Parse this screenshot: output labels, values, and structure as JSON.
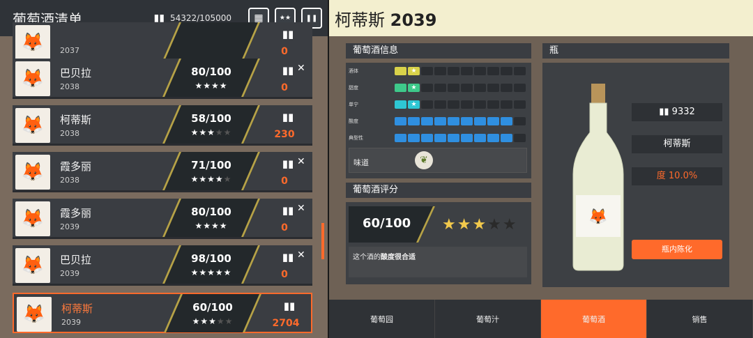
{
  "left": {
    "title": "葡萄酒清单",
    "count_icon": "wine-bottles-icon",
    "count": "54322/105000",
    "buttons": [
      {
        "name": "calendar-icon",
        "glyph": "▦"
      },
      {
        "name": "stars-icon",
        "glyph": "★★"
      },
      {
        "name": "wine-bottles-icon",
        "glyph": "❚❚"
      }
    ]
  },
  "wines": [
    {
      "name": "",
      "year": "2037",
      "score": "",
      "stars": "",
      "qty": "0",
      "close": false,
      "selected": false
    },
    {
      "name": "巴贝拉",
      "year": "2038",
      "score": "80/100",
      "stars_on": "★★★★",
      "stars_off": "",
      "qty": "0",
      "close": true,
      "selected": false
    },
    {
      "name": "柯蒂斯",
      "year": "2038",
      "score": "58/100",
      "stars_on": "★★★",
      "stars_off": "★★",
      "qty": "230",
      "close": false,
      "selected": false
    },
    {
      "name": "霞多丽",
      "year": "2038",
      "score": "71/100",
      "stars_on": "★★★★",
      "stars_off": "★",
      "qty": "0",
      "close": true,
      "selected": false
    },
    {
      "name": "霞多丽",
      "year": "2039",
      "score": "80/100",
      "stars_on": "★★★★",
      "stars_off": "",
      "qty": "0",
      "close": true,
      "selected": false
    },
    {
      "name": "巴贝拉",
      "year": "2039",
      "score": "98/100",
      "stars_on": "★★★★★",
      "stars_off": "",
      "qty": "0",
      "close": true,
      "selected": false
    },
    {
      "name": "柯蒂斯",
      "year": "2039",
      "score": "60/100",
      "stars_on": "★★★",
      "stars_off": "★★",
      "qty": "2704",
      "close": false,
      "selected": true
    }
  ],
  "close_glyph": "✕",
  "fox_glyph": "🦊",
  "bottles_glyph": "▮▮",
  "right": {
    "title_name": "柯蒂斯",
    "title_year": "2039",
    "info_header": "葡萄酒信息",
    "traits": [
      {
        "label": "酒体",
        "level": 2,
        "color": "#d9d24a",
        "star": true
      },
      {
        "label": "甜度",
        "level": 2,
        "color": "#3ec98a",
        "star": true
      },
      {
        "label": "单宁",
        "level": 2,
        "color": "#2ec7d4",
        "star": true
      },
      {
        "label": "酸度",
        "level": 9,
        "color": "#2f8fe0",
        "star": false
      },
      {
        "label": "典型性",
        "level": 9,
        "color": "#2f8fe0",
        "star": false
      }
    ],
    "flavor_label": "味道",
    "flavor_icon": "herb-icon",
    "rating_header": "葡萄酒评分",
    "rating_score": "60/100",
    "rating_stars_on": "★★★",
    "rating_stars_off": "★★",
    "comment_prefix": "这个酒的",
    "comment_bold": "酸度很合适",
    "bottle_header": "瓶",
    "bottle_count": "9332",
    "bottle_name": "柯蒂斯",
    "bottle_degree": "度 10.0%",
    "cellar_button": "瓶内陈化"
  },
  "tabs": [
    {
      "label": "葡萄园",
      "active": false
    },
    {
      "label": "葡萄汁",
      "active": false
    },
    {
      "label": "葡萄酒",
      "active": true
    },
    {
      "label": "销售",
      "active": false
    }
  ]
}
